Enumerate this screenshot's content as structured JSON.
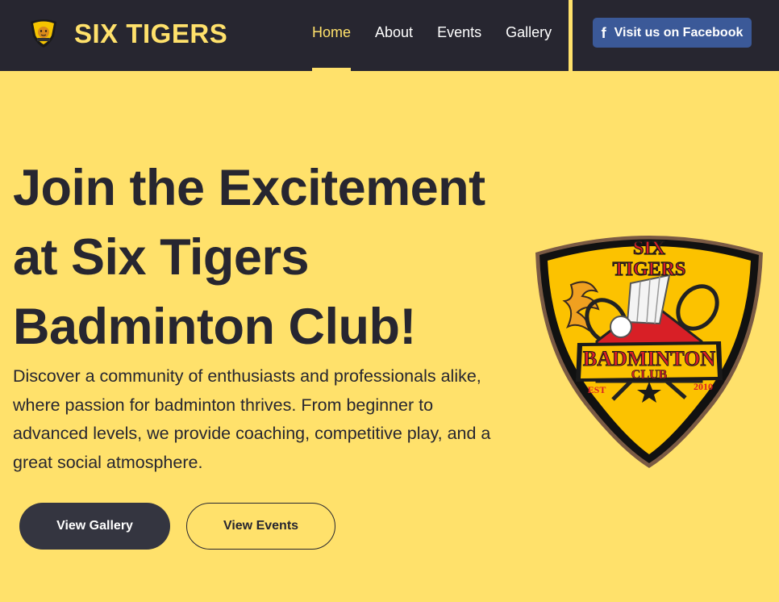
{
  "header": {
    "brand_name": "SIX TIGERS",
    "brand_logo_icon": "tiger-shield-icon",
    "nav": [
      {
        "label": "Home",
        "active": true
      },
      {
        "label": "About",
        "active": false
      },
      {
        "label": "Events",
        "active": false
      },
      {
        "label": "Gallery",
        "active": false
      }
    ],
    "facebook_button": {
      "label": "Visit us on Facebook",
      "icon": "facebook-icon"
    }
  },
  "hero": {
    "heading_lines": [
      "Join the Excitement",
      "at Six Tigers",
      "Badminton Club!"
    ],
    "description": "Discover a community of enthusiasts and professionals alike, where passion for badminton thrives. From beginner to advanced levels, we provide coaching, competitive play, and a great social atmosphere.",
    "primary_button": "View Gallery",
    "secondary_button": "View Events"
  },
  "club_logo": {
    "icon": "badminton-club-shield-icon",
    "title_line1": "SIX",
    "title_line2": "TIGERS",
    "banner_line1": "BADMINTON",
    "banner_line2": "CLUB",
    "est_label": "EST",
    "est_year": "2010"
  },
  "colors": {
    "nav_background": "#272630",
    "accent_yellow": "#ffe16b",
    "text_dark": "#272630",
    "facebook_blue": "#3b5998",
    "button_dark": "#343540"
  }
}
